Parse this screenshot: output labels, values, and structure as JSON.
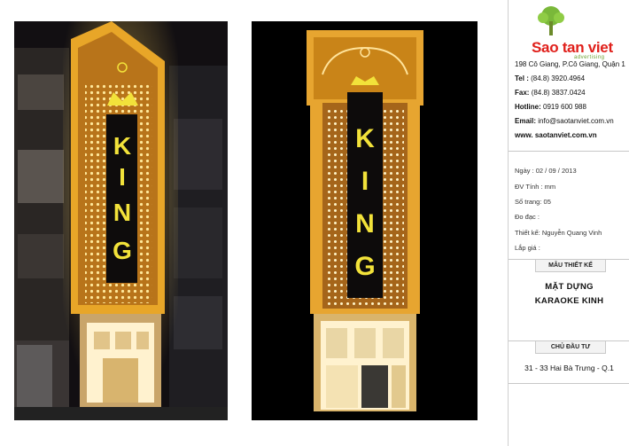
{
  "company": {
    "brand": "Sao tan viet",
    "tagline": "advertising",
    "address": "198 Cô Giang, P.Cô Giang, Quận 1",
    "tel_label": "Tel :",
    "tel": "(84.8) 3920.4964",
    "fax_label": "Fax:",
    "fax": "(84.8) 3837.0424",
    "hotline_label": "Hotline:",
    "hotline": "0919 600 988",
    "email_label": "Email:",
    "email": "info@saotanviet.com.vn",
    "website": "www. saotanviet.com.vn"
  },
  "meta": {
    "date": "Ngày : 02 / 09 / 2013",
    "unit": "ĐV Tính : mm",
    "pages": "Số trang: 05",
    "measure": "Đo đạc :",
    "designer": "Thiết kế: Nguyễn Quang Vinh",
    "installer": "Lắp giá :"
  },
  "design": {
    "heading": "MẪU THIẾT KẾ",
    "title_line1": "MẶT DỰNG",
    "title_line2": "KARAOKE KINH"
  },
  "owner": {
    "heading": "CHỦ ĐẦU TƯ",
    "address": "31 - 33 Hai Bà Trưng - Q.1"
  },
  "sign": {
    "text": "KING",
    "crest_text": "KING",
    "registered": "R"
  },
  "colors": {
    "gold": "#e8a628",
    "sign_yellow": "#f2e23a",
    "brand_red": "#e0201b",
    "brand_green": "#6aa12f"
  }
}
